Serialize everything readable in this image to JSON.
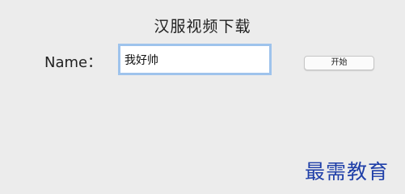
{
  "window": {
    "title": "汉服视频下载"
  },
  "form": {
    "name_label": "Name：",
    "name_value": "我好帅",
    "start_label": "开始"
  },
  "watermark": {
    "text": "最需教育"
  },
  "colors": {
    "background": "#ececec",
    "focus_ring": "#9ec3ec",
    "watermark": "#1f3fa8"
  }
}
